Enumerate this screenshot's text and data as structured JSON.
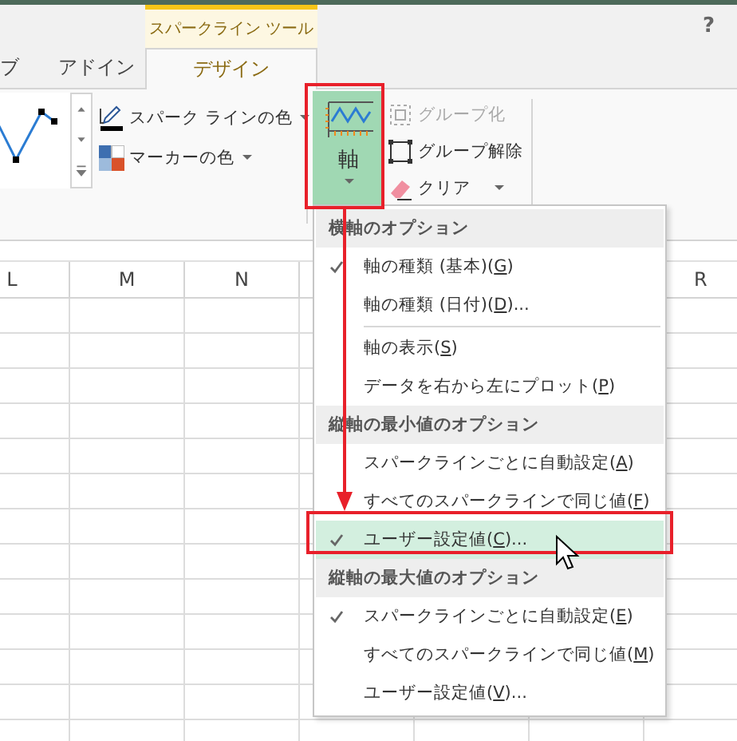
{
  "ribbon": {
    "contextual_group": "スパークライン ツール",
    "help": "?",
    "tabs": [
      {
        "label": "ブ",
        "selected": false
      },
      {
        "label": "アドイン",
        "selected": false
      },
      {
        "label": "デザイン",
        "selected": true
      }
    ],
    "style_commands": [
      {
        "kind": "line-color",
        "label": "スパーク ラインの色"
      },
      {
        "kind": "marker-color",
        "label": "マーカーの色"
      }
    ],
    "axis_button": {
      "label": "軸",
      "expanded": true
    },
    "group_commands": [
      {
        "kind": "group",
        "label": "グループ化",
        "disabled": true
      },
      {
        "kind": "ungroup",
        "label": "グループ解除",
        "disabled": false
      },
      {
        "kind": "clear",
        "label": "クリア",
        "disabled": false
      }
    ]
  },
  "columns": [
    {
      "label": "L"
    },
    {
      "label": "M"
    },
    {
      "label": "N"
    },
    {
      "label": "R"
    }
  ],
  "axis_menu": {
    "items": [
      {
        "kind": "heading",
        "text": "横軸のオプション"
      },
      {
        "kind": "item",
        "before": "軸の種類 (基本)(",
        "key": "G",
        "after": ")",
        "checked": true,
        "selected": false
      },
      {
        "kind": "item",
        "before": "軸の種類 (日付)(",
        "key": "D",
        "after": ")...",
        "checked": false,
        "selected": false
      },
      {
        "kind": "separator"
      },
      {
        "kind": "item",
        "before": "軸の表示(",
        "key": "S",
        "after": ")",
        "checked": false,
        "selected": false
      },
      {
        "kind": "item",
        "before": "データを右から左にプロット(",
        "key": "P",
        "after": ")",
        "checked": false,
        "selected": false
      },
      {
        "kind": "heading",
        "text": "縦軸の最小値のオプション"
      },
      {
        "kind": "item",
        "before": "スパークラインごとに自動設定(",
        "key": "A",
        "after": ")",
        "checked": false,
        "selected": false
      },
      {
        "kind": "item",
        "before": "すべてのスパークラインで同じ値(",
        "key": "F",
        "after": ")",
        "checked": false,
        "selected": false
      },
      {
        "kind": "item",
        "before": "ユーザー設定値(",
        "key": "C",
        "after": ")...",
        "checked": true,
        "selected": true
      },
      {
        "kind": "heading",
        "text": "縦軸の最大値のオプション"
      },
      {
        "kind": "item",
        "before": "スパークラインごとに自動設定(",
        "key": "E",
        "after": ")",
        "checked": true,
        "selected": false
      },
      {
        "kind": "item",
        "before": "すべてのスパークラインで同じ値(",
        "key": "M",
        "after": ")",
        "checked": false,
        "selected": false
      },
      {
        "kind": "item",
        "before": "ユーザー設定値(",
        "key": "V",
        "after": ")...",
        "checked": false,
        "selected": false
      }
    ]
  }
}
